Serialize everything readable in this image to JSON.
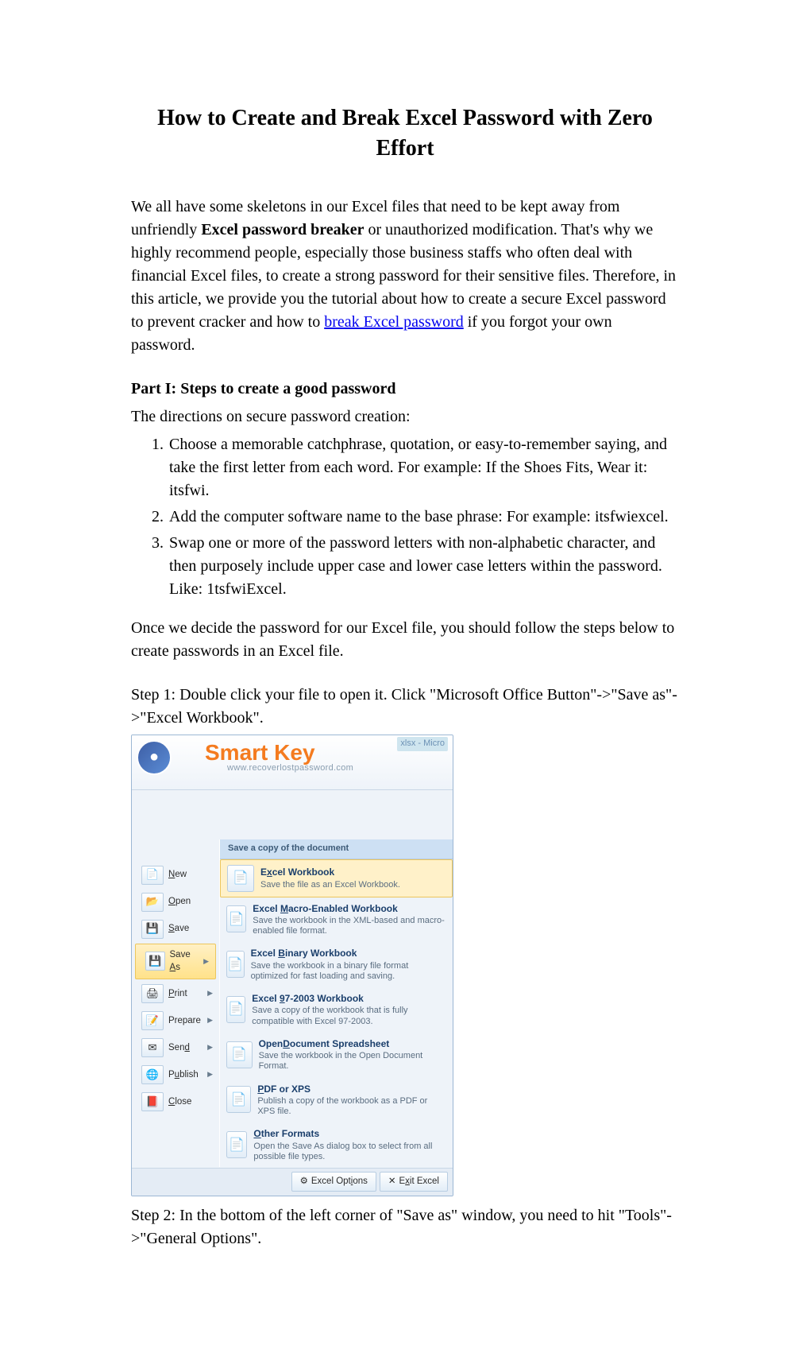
{
  "title": "How to Create and Break Excel Password with Zero Effort",
  "intro": {
    "pre": "We all have some skeletons in our Excel files that need to be kept away from unfriendly ",
    "bold1": "Excel password breaker",
    "mid1": " or unauthorized modification. That's why we highly recommend people, especially those business staffs who often deal with financial Excel files, to create a strong password for their sensitive files. Therefore, in this article, we provide you the tutorial about how to create a secure Excel password to prevent cracker and how to ",
    "link_text": "break Excel password",
    "post": " if you forgot your own password."
  },
  "part1_heading": "Part I: Steps to create a good password",
  "directions_intro": "The directions on secure password creation:",
  "list": [
    "Choose a memorable catchphrase, quotation, or easy-to-remember saying, and take the first letter from each word. For example: If the Shoes Fits, Wear it: itsfwi.",
    "Add the computer software name to the base phrase: For example: itsfwiexcel.",
    "Swap one or more of the password letters with non-alphabetic character, and then purposely include upper case and lower case letters within the password. Like: 1tsfwiExcel."
  ],
  "after_list": "Once we decide the password for our Excel file, you should follow the steps below to create passwords in an Excel file.",
  "step1": "Step 1: Double click your file to open it. Click \"Microsoft Office Button\"->\"Save as\"->\"Excel Workbook\".",
  "step2": "Step 2: In the bottom of the left corner of \"Save as\" window, you need to hit \"Tools\"->\"General Options\".",
  "screenshot": {
    "brand": "Smart Key",
    "brand_sub": "www.recoverlostpassword.com",
    "corner_badge": "xlsx - Micro",
    "save_copy_header": "Save a copy of the document",
    "left_menu": [
      {
        "label": "New",
        "underline": "N",
        "arrow": false,
        "icon": "📄"
      },
      {
        "label": "Open",
        "underline": "O",
        "arrow": false,
        "icon": "📂"
      },
      {
        "label": "Save",
        "underline": "S",
        "arrow": false,
        "icon": "💾"
      },
      {
        "label": "Save As",
        "underline": "A",
        "arrow": true,
        "icon": "💾",
        "selected": true
      },
      {
        "label": "Print",
        "underline": "P",
        "arrow": true,
        "icon": "🖨"
      },
      {
        "label": "Prepare",
        "underline": "E",
        "arrow": true,
        "icon": "📝"
      },
      {
        "label": "Send",
        "underline": "d",
        "arrow": true,
        "icon": "✉"
      },
      {
        "label": "Publish",
        "underline": "u",
        "arrow": true,
        "icon": "🌐"
      },
      {
        "label": "Close",
        "underline": "C",
        "arrow": false,
        "icon": "📕"
      }
    ],
    "right_menu": [
      {
        "title": "Excel Workbook",
        "sub": "Save the file as an Excel Workbook.",
        "hl": true,
        "underline": "x"
      },
      {
        "title": "Excel Macro-Enabled Workbook",
        "sub": "Save the workbook in the XML-based and macro-enabled file format.",
        "underline": "M"
      },
      {
        "title": "Excel Binary Workbook",
        "sub": "Save the workbook in a binary file format optimized for fast loading and saving.",
        "underline": "B"
      },
      {
        "title": "Excel 97-2003 Workbook",
        "sub": "Save a copy of the workbook that is fully compatible with Excel 97-2003.",
        "underline": "9"
      },
      {
        "title": "OpenDocument Spreadsheet",
        "sub": "Save the workbook in the Open Document Format.",
        "underline": "D"
      },
      {
        "title": "PDF or XPS",
        "sub": "Publish a copy of the workbook as a PDF or XPS file.",
        "underline": "P"
      },
      {
        "title": "Other Formats",
        "sub": "Open the Save As dialog box to select from all possible file types.",
        "underline": "O"
      }
    ],
    "bottom": {
      "options": "Excel Options",
      "options_ul": "i",
      "exit": "Exit Excel",
      "exit_ul": "x"
    }
  }
}
